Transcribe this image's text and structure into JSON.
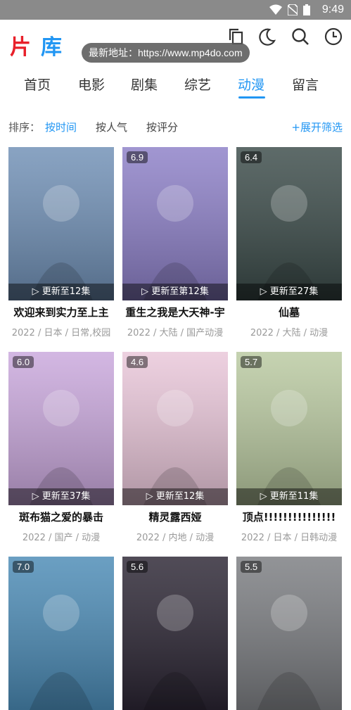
{
  "status": {
    "time": "9:49"
  },
  "app": {
    "logo": "片库",
    "logo_part1": "片",
    "logo_part2": "库"
  },
  "tooltip": {
    "text": "最新地址：https://www.mp4do.com"
  },
  "tabs": [
    {
      "label": "首页"
    },
    {
      "label": "电影"
    },
    {
      "label": "剧集"
    },
    {
      "label": "综艺"
    },
    {
      "label": "动漫",
      "active": true
    },
    {
      "label": "留言"
    }
  ],
  "sort": {
    "label": "排序：",
    "options": [
      "按时间",
      "按人气",
      "按评分"
    ],
    "active_index": 0,
    "expand_label": "+展开筛选"
  },
  "cards": [
    {
      "score": "",
      "update": "▷ 更新至12集",
      "title": "欢迎来到实力至上主",
      "meta": "2022 / 日本 / 日常,校园",
      "bg": "#6f8fb5"
    },
    {
      "score": "6.9",
      "update": "▷ 更新至第12集",
      "title": "重生之我是大天神-宇",
      "meta": "2022 / 大陆 / 国产动漫",
      "bg": "#8c7fc7"
    },
    {
      "score": "6.4",
      "update": "▷ 更新至27集",
      "title": "仙墓",
      "meta": "2022 / 大陆 / 动漫",
      "bg": "#3a4a48"
    },
    {
      "score": "6.0",
      "update": "▷ 更新至37集",
      "title": "斑布猫之爱的暴击",
      "meta": "2022 / 国产 / 动漫",
      "bg": "#c9a7dc"
    },
    {
      "score": "4.6",
      "update": "▷ 更新至12集",
      "title": "精灵露西娅",
      "meta": "2022 / 内地 / 动漫",
      "bg": "#e9c6d9"
    },
    {
      "score": "5.7",
      "update": "▷ 更新至11集",
      "title": "顶点!!!!!!!!!!!!!!!",
      "meta": "2022 / 日本 / 日韩动漫",
      "bg": "#b9c9a0"
    },
    {
      "score": "7.0",
      "update": "",
      "title": "",
      "meta": "",
      "bg": "#4a8ab5"
    },
    {
      "score": "5.6",
      "update": "",
      "title": "",
      "meta": "",
      "bg": "#2a2432"
    },
    {
      "score": "5.5",
      "update": "",
      "title": "",
      "meta": "",
      "bg": "#7a7c80"
    }
  ]
}
